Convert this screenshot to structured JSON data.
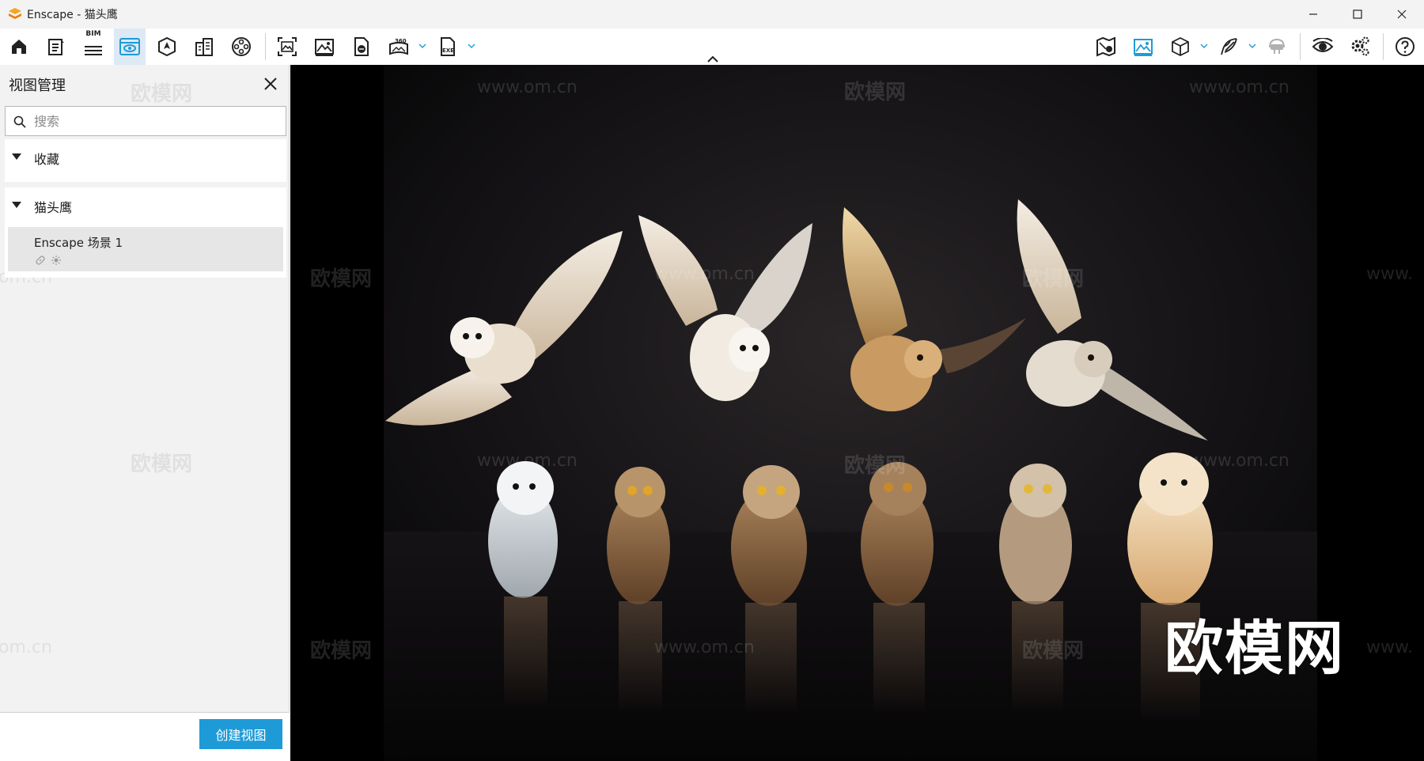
{
  "window": {
    "title": "Enscape - 猫头鹰",
    "controls": [
      "minimize-icon",
      "maximize-icon",
      "close-icon"
    ]
  },
  "toolbar": {
    "bim_label": "BIM",
    "left_icons": [
      "home-icon",
      "notes-icon",
      "bim-list-icon",
      "view-management-icon",
      "atmosphere-icon",
      "buildings-icon",
      "video-editor-icon",
      "screenshot-icon",
      "render-image-icon",
      "panorama-export-icon",
      "360-panorama-icon",
      "exe-export-icon"
    ],
    "right_icons": [
      "minimap-icon",
      "visual-settings-icon",
      "cube-icon",
      "feather-icon",
      "vr-headset-icon",
      "preview-eye-icon",
      "settings-icon",
      "help-icon"
    ]
  },
  "panel": {
    "title": "视图管理",
    "search_placeholder": "搜索",
    "sections": [
      {
        "label": "收藏",
        "expanded": true
      },
      {
        "label": "猫头鹰",
        "expanded": true,
        "items": [
          {
            "name": "Enscape 场景 1"
          }
        ]
      }
    ],
    "create_button": "创建视图"
  },
  "viewport": {
    "watermark_text": "欧模网",
    "watermark_url": "www.om.cn",
    "watermark_url_partial": "om.cn",
    "watermark_url_left": "www.",
    "big_watermark": "欧模网"
  },
  "colors": {
    "accent": "#1e9bd7",
    "active_tab": "#dde9f5",
    "viewport_bg": "#0b0a0c"
  }
}
